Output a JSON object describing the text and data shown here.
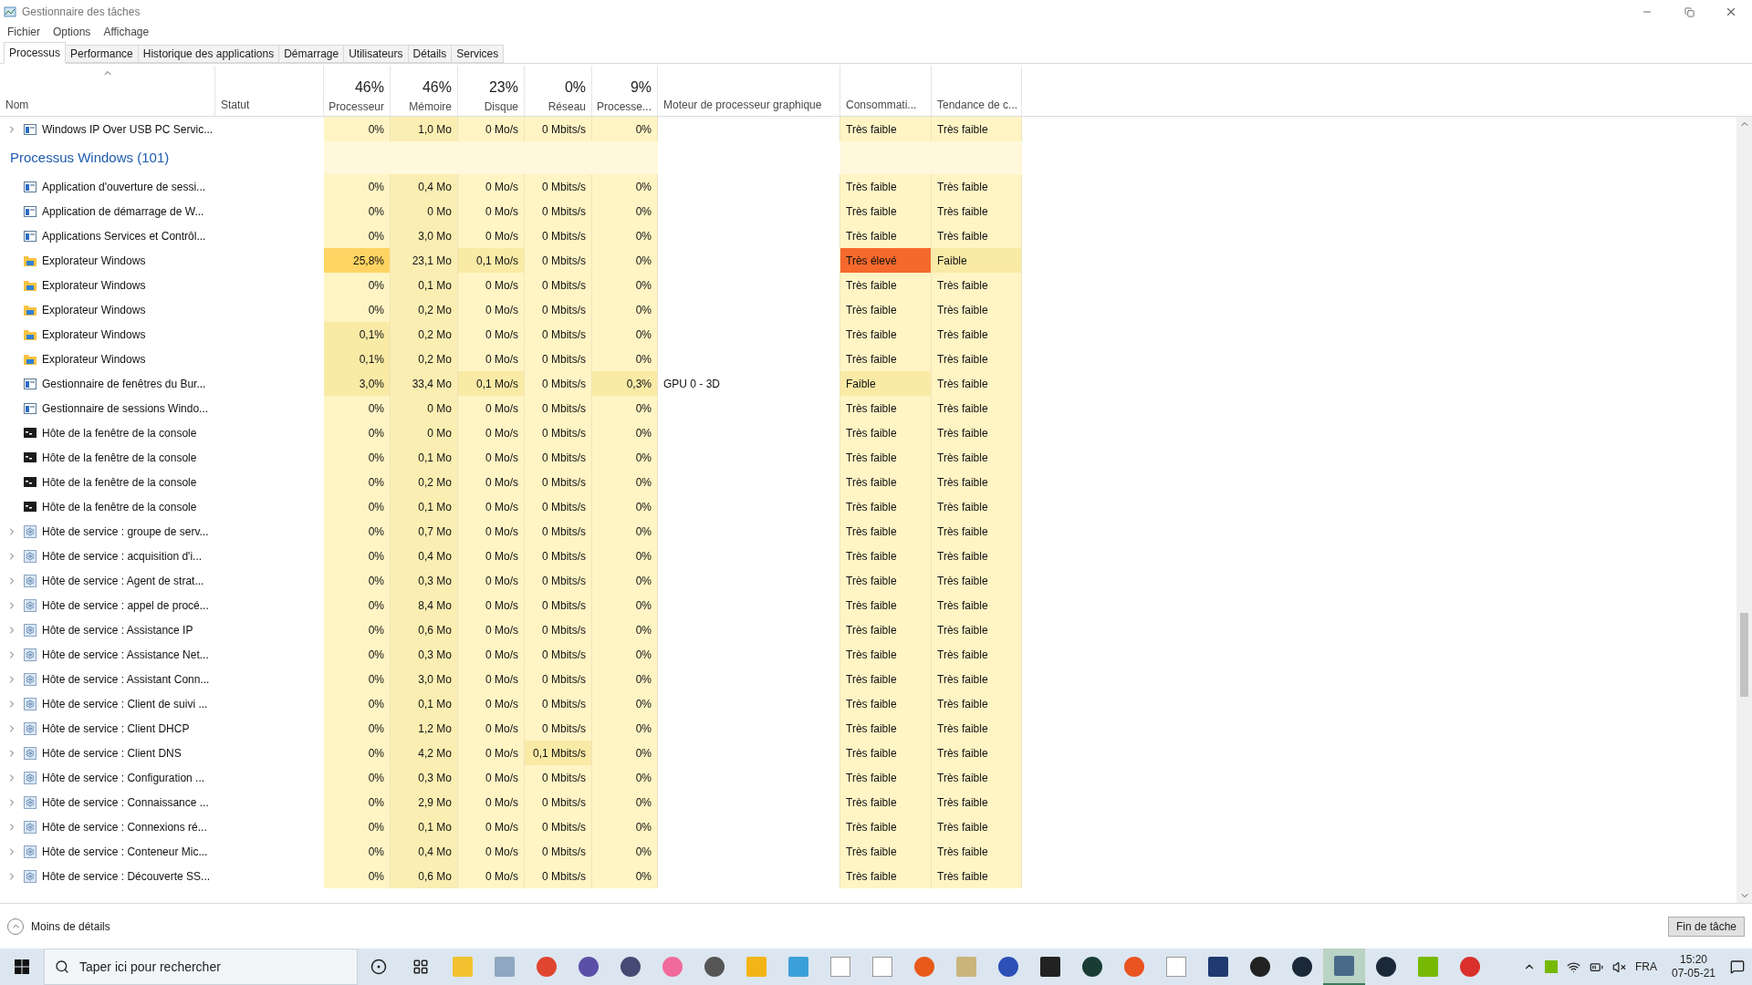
{
  "window": {
    "title": "Gestionnaire des tâches"
  },
  "menu": [
    "Fichier",
    "Options",
    "Affichage"
  ],
  "tabs": [
    {
      "label": "Processus",
      "selected": true
    },
    {
      "label": "Performance",
      "selected": false
    },
    {
      "label": "Historique des applications",
      "selected": false
    },
    {
      "label": "Démarrage",
      "selected": false
    },
    {
      "label": "Utilisateurs",
      "selected": false
    },
    {
      "label": "Détails",
      "selected": false
    },
    {
      "label": "Services",
      "selected": false
    }
  ],
  "columns": [
    {
      "label": "Nom",
      "sorted": true
    },
    {
      "label": "Statut",
      "sorted": false
    },
    {
      "percent": "46%",
      "label": "Processeur",
      "sorted": false
    },
    {
      "percent": "46%",
      "label": "Mémoire",
      "sorted": false
    },
    {
      "percent": "23%",
      "label": "Disque",
      "sorted": false
    },
    {
      "percent": "0%",
      "label": "Réseau",
      "sorted": false
    },
    {
      "percent": "9%",
      "label": "Processe...",
      "sorted": false
    },
    {
      "label": "Moteur de processeur graphique",
      "sorted": false
    },
    {
      "label": "Consommati...",
      "sorted": false
    },
    {
      "label": "Tendance de c...",
      "sorted": false
    }
  ],
  "rows": [
    {
      "kind": "app",
      "expandable": true,
      "name": "Windows IP Over USB PC Servic...",
      "cells": [
        {
          "text": "0%"
        },
        {
          "text": "1,0 Mo"
        },
        {
          "text": "0 Mo/s"
        },
        {
          "text": "0 Mbits/s"
        },
        {
          "text": "0%"
        },
        {},
        {
          "text": "Très faible"
        },
        {
          "text": "Très faible"
        }
      ]
    },
    {
      "kind": "group",
      "name": "Processus Windows (101)"
    },
    {
      "kind": "app",
      "expandable": false,
      "name": "Application d'ouverture de sessi...",
      "cells": [
        {
          "text": "0%"
        },
        {
          "text": "0,4 Mo"
        },
        {
          "text": "0 Mo/s"
        },
        {
          "text": "0 Mbits/s"
        },
        {
          "text": "0%"
        },
        {},
        {
          "text": "Très faible"
        },
        {
          "text": "Très faible"
        }
      ]
    },
    {
      "kind": "app",
      "expandable": false,
      "name": "Application de démarrage de W...",
      "cells": [
        {
          "text": "0%"
        },
        {
          "text": "0 Mo"
        },
        {
          "text": "0 Mo/s"
        },
        {
          "text": "0 Mbits/s"
        },
        {
          "text": "0%"
        },
        {},
        {
          "text": "Très faible"
        },
        {
          "text": "Très faible"
        }
      ]
    },
    {
      "kind": "app",
      "expandable": false,
      "name": "Applications Services et Contrôl...",
      "cells": [
        {
          "text": "0%"
        },
        {
          "text": "3,0 Mo"
        },
        {
          "text": "0 Mo/s"
        },
        {
          "text": "0 Mbits/s"
        },
        {
          "text": "0%"
        },
        {},
        {
          "text": "Très faible"
        },
        {
          "text": "Très faible"
        }
      ]
    },
    {
      "kind": "folder",
      "expandable": false,
      "name": "Explorateur Windows",
      "cells": [
        {
          "text": "25,8%",
          "color": "#ffd463"
        },
        {
          "text": "23,1 Mo"
        },
        {
          "text": "0,1 Mo/s",
          "color": "#f9eaa6"
        },
        {
          "text": "0 Mbits/s"
        },
        {
          "text": "0%"
        },
        {},
        {
          "text": "Très élevé",
          "color": "#f5692c"
        },
        {
          "text": "Faible",
          "color": "#f9eaa6"
        }
      ]
    },
    {
      "kind": "folder",
      "expandable": false,
      "name": "Explorateur Windows",
      "cells": [
        {
          "text": "0%"
        },
        {
          "text": "0,1 Mo"
        },
        {
          "text": "0 Mo/s"
        },
        {
          "text": "0 Mbits/s"
        },
        {
          "text": "0%"
        },
        {},
        {
          "text": "Très faible"
        },
        {
          "text": "Très faible"
        }
      ]
    },
    {
      "kind": "folder",
      "expandable": false,
      "name": "Explorateur Windows",
      "cells": [
        {
          "text": "0%"
        },
        {
          "text": "0,2 Mo"
        },
        {
          "text": "0 Mo/s"
        },
        {
          "text": "0 Mbits/s"
        },
        {
          "text": "0%"
        },
        {},
        {
          "text": "Très faible"
        },
        {
          "text": "Très faible"
        }
      ]
    },
    {
      "kind": "folder",
      "expandable": false,
      "name": "Explorateur Windows",
      "cells": [
        {
          "text": "0,1%",
          "color": "#f9eaa6"
        },
        {
          "text": "0,2 Mo"
        },
        {
          "text": "0 Mo/s"
        },
        {
          "text": "0 Mbits/s"
        },
        {
          "text": "0%"
        },
        {},
        {
          "text": "Très faible"
        },
        {
          "text": "Très faible"
        }
      ]
    },
    {
      "kind": "folder",
      "expandable": false,
      "name": "Explorateur Windows",
      "cells": [
        {
          "text": "0,1%",
          "color": "#f9eaa6"
        },
        {
          "text": "0,2 Mo"
        },
        {
          "text": "0 Mo/s"
        },
        {
          "text": "0 Mbits/s"
        },
        {
          "text": "0%"
        },
        {},
        {
          "text": "Très faible"
        },
        {
          "text": "Très faible"
        }
      ]
    },
    {
      "kind": "app",
      "expandable": false,
      "name": "Gestionnaire de fenêtres du Bur...",
      "cells": [
        {
          "text": "3,0%",
          "color": "#f9eaa6"
        },
        {
          "text": "33,4 Mo"
        },
        {
          "text": "0,1 Mo/s",
          "color": "#f9eaa6"
        },
        {
          "text": "0 Mbits/s"
        },
        {
          "text": "0,3%",
          "color": "#f9eaa6"
        },
        {
          "text": "GPU 0 - 3D"
        },
        {
          "text": "Faible",
          "color": "#f9eaa6"
        },
        {
          "text": "Très faible"
        }
      ]
    },
    {
      "kind": "app",
      "expandable": false,
      "name": "Gestionnaire de sessions Windo...",
      "cells": [
        {
          "text": "0%"
        },
        {
          "text": "0 Mo"
        },
        {
          "text": "0 Mo/s"
        },
        {
          "text": "0 Mbits/s"
        },
        {
          "text": "0%"
        },
        {},
        {
          "text": "Très faible"
        },
        {
          "text": "Très faible"
        }
      ]
    },
    {
      "kind": "console",
      "expandable": false,
      "name": "Hôte de la fenêtre de la console",
      "cells": [
        {
          "text": "0%"
        },
        {
          "text": "0 Mo"
        },
        {
          "text": "0 Mo/s"
        },
        {
          "text": "0 Mbits/s"
        },
        {
          "text": "0%"
        },
        {},
        {
          "text": "Très faible"
        },
        {
          "text": "Très faible"
        }
      ]
    },
    {
      "kind": "console",
      "expandable": false,
      "name": "Hôte de la fenêtre de la console",
      "cells": [
        {
          "text": "0%"
        },
        {
          "text": "0,1 Mo"
        },
        {
          "text": "0 Mo/s"
        },
        {
          "text": "0 Mbits/s"
        },
        {
          "text": "0%"
        },
        {},
        {
          "text": "Très faible"
        },
        {
          "text": "Très faible"
        }
      ]
    },
    {
      "kind": "console",
      "expandable": false,
      "name": "Hôte de la fenêtre de la console",
      "cells": [
        {
          "text": "0%"
        },
        {
          "text": "0,2 Mo"
        },
        {
          "text": "0 Mo/s"
        },
        {
          "text": "0 Mbits/s"
        },
        {
          "text": "0%"
        },
        {},
        {
          "text": "Très faible"
        },
        {
          "text": "Très faible"
        }
      ]
    },
    {
      "kind": "console",
      "expandable": false,
      "name": "Hôte de la fenêtre de la console",
      "cells": [
        {
          "text": "0%"
        },
        {
          "text": "0,1 Mo"
        },
        {
          "text": "0 Mo/s"
        },
        {
          "text": "0 Mbits/s"
        },
        {
          "text": "0%"
        },
        {},
        {
          "text": "Très faible"
        },
        {
          "text": "Très faible"
        }
      ]
    },
    {
      "kind": "service",
      "expandable": true,
      "name": "Hôte de service : groupe de serv...",
      "cells": [
        {
          "text": "0%"
        },
        {
          "text": "0,7 Mo"
        },
        {
          "text": "0 Mo/s"
        },
        {
          "text": "0 Mbits/s"
        },
        {
          "text": "0%"
        },
        {},
        {
          "text": "Très faible"
        },
        {
          "text": "Très faible"
        }
      ]
    },
    {
      "kind": "service",
      "expandable": true,
      "name": "Hôte de service : acquisition d'i...",
      "cells": [
        {
          "text": "0%"
        },
        {
          "text": "0,4 Mo"
        },
        {
          "text": "0 Mo/s"
        },
        {
          "text": "0 Mbits/s"
        },
        {
          "text": "0%"
        },
        {},
        {
          "text": "Très faible"
        },
        {
          "text": "Très faible"
        }
      ]
    },
    {
      "kind": "service",
      "expandable": true,
      "name": "Hôte de service : Agent de strat...",
      "cells": [
        {
          "text": "0%"
        },
        {
          "text": "0,3 Mo"
        },
        {
          "text": "0 Mo/s"
        },
        {
          "text": "0 Mbits/s"
        },
        {
          "text": "0%"
        },
        {},
        {
          "text": "Très faible"
        },
        {
          "text": "Très faible"
        }
      ]
    },
    {
      "kind": "service",
      "expandable": true,
      "name": "Hôte de service : appel de procé...",
      "cells": [
        {
          "text": "0%"
        },
        {
          "text": "8,4 Mo"
        },
        {
          "text": "0 Mo/s"
        },
        {
          "text": "0 Mbits/s"
        },
        {
          "text": "0%"
        },
        {},
        {
          "text": "Très faible"
        },
        {
          "text": "Très faible"
        }
      ]
    },
    {
      "kind": "service",
      "expandable": true,
      "name": "Hôte de service : Assistance IP",
      "cells": [
        {
          "text": "0%"
        },
        {
          "text": "0,6 Mo"
        },
        {
          "text": "0 Mo/s"
        },
        {
          "text": "0 Mbits/s"
        },
        {
          "text": "0%"
        },
        {},
        {
          "text": "Très faible"
        },
        {
          "text": "Très faible"
        }
      ]
    },
    {
      "kind": "service",
      "expandable": true,
      "name": "Hôte de service : Assistance Net...",
      "cells": [
        {
          "text": "0%"
        },
        {
          "text": "0,3 Mo"
        },
        {
          "text": "0 Mo/s"
        },
        {
          "text": "0 Mbits/s"
        },
        {
          "text": "0%"
        },
        {},
        {
          "text": "Très faible"
        },
        {
          "text": "Très faible"
        }
      ]
    },
    {
      "kind": "service",
      "expandable": true,
      "name": "Hôte de service : Assistant Conn...",
      "cells": [
        {
          "text": "0%"
        },
        {
          "text": "3,0 Mo"
        },
        {
          "text": "0 Mo/s"
        },
        {
          "text": "0 Mbits/s"
        },
        {
          "text": "0%"
        },
        {},
        {
          "text": "Très faible"
        },
        {
          "text": "Très faible"
        }
      ]
    },
    {
      "kind": "service",
      "expandable": true,
      "name": "Hôte de service : Client de suivi ...",
      "cells": [
        {
          "text": "0%"
        },
        {
          "text": "0,1 Mo"
        },
        {
          "text": "0 Mo/s"
        },
        {
          "text": "0 Mbits/s"
        },
        {
          "text": "0%"
        },
        {},
        {
          "text": "Très faible"
        },
        {
          "text": "Très faible"
        }
      ]
    },
    {
      "kind": "service",
      "expandable": true,
      "name": "Hôte de service : Client DHCP",
      "cells": [
        {
          "text": "0%"
        },
        {
          "text": "1,2 Mo"
        },
        {
          "text": "0 Mo/s"
        },
        {
          "text": "0 Mbits/s"
        },
        {
          "text": "0%"
        },
        {},
        {
          "text": "Très faible"
        },
        {
          "text": "Très faible"
        }
      ]
    },
    {
      "kind": "service",
      "expandable": true,
      "name": "Hôte de service : Client DNS",
      "cells": [
        {
          "text": "0%"
        },
        {
          "text": "4,2 Mo"
        },
        {
          "text": "0 Mo/s"
        },
        {
          "text": "0,1 Mbits/s",
          "color": "#f9eaa6"
        },
        {
          "text": "0%"
        },
        {},
        {
          "text": "Très faible"
        },
        {
          "text": "Très faible"
        }
      ]
    },
    {
      "kind": "service",
      "expandable": true,
      "name": "Hôte de service : Configuration ...",
      "cells": [
        {
          "text": "0%"
        },
        {
          "text": "0,3 Mo"
        },
        {
          "text": "0 Mo/s"
        },
        {
          "text": "0 Mbits/s"
        },
        {
          "text": "0%"
        },
        {},
        {
          "text": "Très faible"
        },
        {
          "text": "Très faible"
        }
      ]
    },
    {
      "kind": "service",
      "expandable": true,
      "name": "Hôte de service : Connaissance ...",
      "cells": [
        {
          "text": "0%"
        },
        {
          "text": "2,9 Mo"
        },
        {
          "text": "0 Mo/s"
        },
        {
          "text": "0 Mbits/s"
        },
        {
          "text": "0%"
        },
        {},
        {
          "text": "Très faible"
        },
        {
          "text": "Très faible"
        }
      ]
    },
    {
      "kind": "service",
      "expandable": true,
      "name": "Hôte de service : Connexions ré...",
      "cells": [
        {
          "text": "0%"
        },
        {
          "text": "0,1 Mo"
        },
        {
          "text": "0 Mo/s"
        },
        {
          "text": "0 Mbits/s"
        },
        {
          "text": "0%"
        },
        {},
        {
          "text": "Très faible"
        },
        {
          "text": "Très faible"
        }
      ]
    },
    {
      "kind": "service",
      "expandable": true,
      "name": "Hôte de service : Conteneur Mic...",
      "cells": [
        {
          "text": "0%"
        },
        {
          "text": "0,4 Mo"
        },
        {
          "text": "0 Mo/s"
        },
        {
          "text": "0 Mbits/s"
        },
        {
          "text": "0%"
        },
        {},
        {
          "text": "Très faible"
        },
        {
          "text": "Très faible"
        }
      ]
    },
    {
      "kind": "service",
      "expandable": true,
      "name": "Hôte de service : Découverte SS...",
      "cells": [
        {
          "text": "0%"
        },
        {
          "text": "0,6 Mo"
        },
        {
          "text": "0 Mo/s"
        },
        {
          "text": "0 Mbits/s"
        },
        {
          "text": "0%"
        },
        {},
        {
          "text": "Très faible"
        },
        {
          "text": "Très faible"
        }
      ]
    }
  ],
  "footer": {
    "details_link": "Moins de détails",
    "end_task_button": "Fin de tâche"
  },
  "taskbar": {
    "search_placeholder": "Taper ici pour rechercher",
    "apps": [
      {
        "selected": false
      },
      {
        "selected": false
      },
      {
        "selected": false
      },
      {
        "selected": false
      },
      {
        "selected": false
      },
      {
        "selected": false
      },
      {
        "selected": false
      },
      {
        "selected": false
      },
      {
        "selected": false
      },
      {
        "selected": false
      },
      {
        "selected": false
      },
      {
        "selected": false
      },
      {
        "selected": false
      },
      {
        "selected": false
      },
      {
        "selected": false
      },
      {
        "selected": false
      },
      {
        "selected": false
      },
      {
        "selected": false
      },
      {
        "selected": false
      },
      {
        "selected": false
      },
      {
        "selected": false
      },
      {
        "selected": true
      },
      {
        "selected": false
      },
      {
        "selected": false
      },
      {
        "selected": false
      }
    ],
    "language": "FRA",
    "time": "15:20",
    "date": "07-05-21"
  }
}
